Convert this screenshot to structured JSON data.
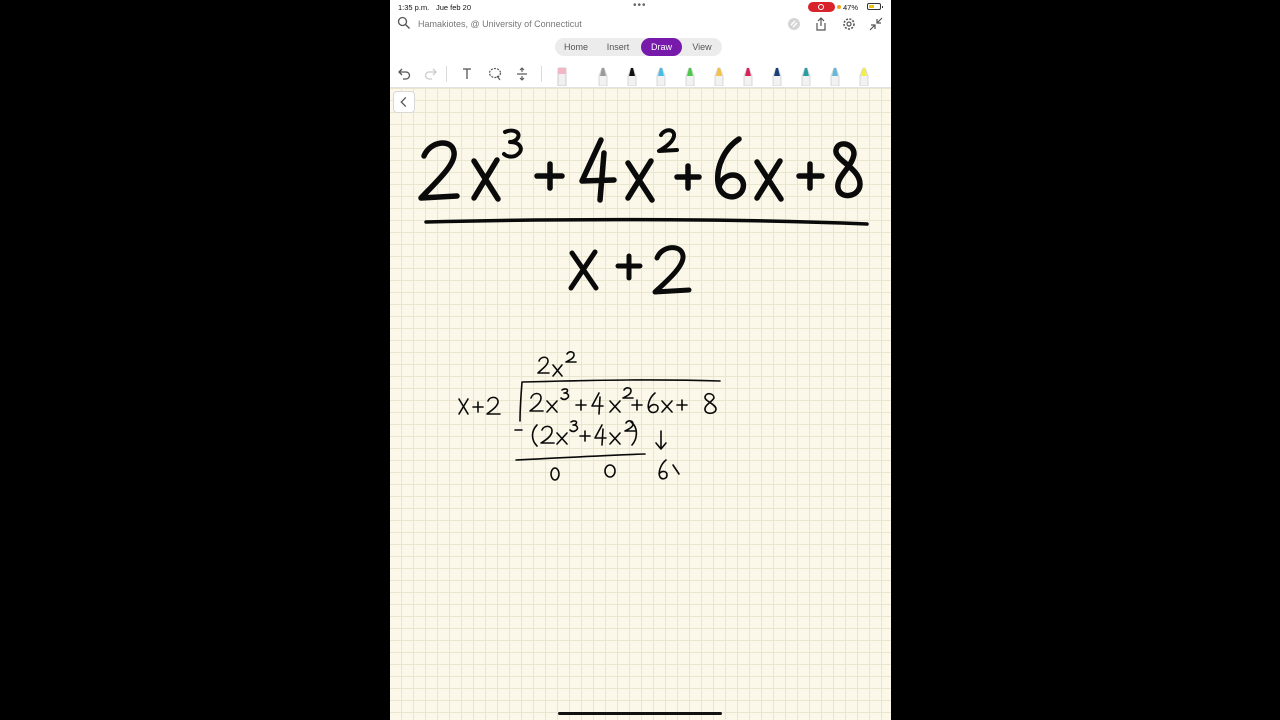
{
  "status": {
    "time": "1:35 p.m.",
    "date": "Jue feb 20",
    "battery": "47%",
    "battery_level": 0.47,
    "rec_color": "#d8232a"
  },
  "notebook": {
    "title": "Hamakiotes, @ University of Connecticut"
  },
  "tabs": [
    {
      "label": "Home",
      "active": false
    },
    {
      "label": "Insert",
      "active": false
    },
    {
      "label": "Draw",
      "active": true
    },
    {
      "label": "View",
      "active": false
    }
  ],
  "accent_color": "#7719aa",
  "toolbar": {
    "tools": [
      "undo-icon",
      "redo-icon",
      "text-mode-icon",
      "lasso-select-icon",
      "add-space-icon",
      "eraser-icon"
    ],
    "pens": [
      {
        "name": "pencil",
        "color": "#9a9a9a"
      },
      {
        "name": "black-pen",
        "color": "#111111"
      },
      {
        "name": "light-blue-pen",
        "color": "#45bde6"
      },
      {
        "name": "green-pen",
        "color": "#4cc94c"
      },
      {
        "name": "yellow-orange-pen",
        "color": "#f4c242"
      },
      {
        "name": "red-pen",
        "color": "#d6245b"
      },
      {
        "name": "navy-pen",
        "color": "#1b3d7a"
      },
      {
        "name": "teal-pen",
        "color": "#2a9d9f"
      },
      {
        "name": "sky-pen",
        "color": "#66b8d9"
      },
      {
        "name": "yellow-highlighter",
        "color": "#f3ee4a"
      }
    ]
  },
  "ink": {
    "numerator": "2x³ + 4x² + 6x + 8",
    "denominator": "x + 2",
    "quotient": "2x²",
    "divisor": "x+2",
    "dividend": "2x³+4x²+6x+8",
    "subtract": "-(2x³+4x²)",
    "remainder_row": "0  0  6x"
  }
}
